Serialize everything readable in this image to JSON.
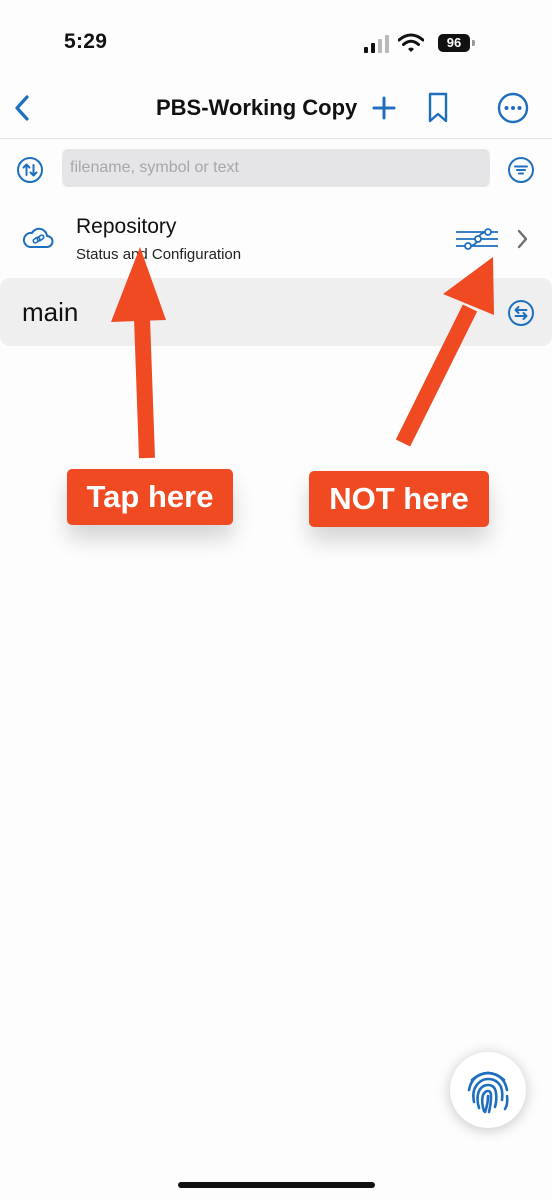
{
  "status_bar": {
    "time": "5:29",
    "battery": "96",
    "icons": [
      "cell-signal-icon",
      "wifi-icon",
      "battery-icon"
    ]
  },
  "nav": {
    "title": "PBS-Working Copy",
    "icons": [
      "chevron-left-icon",
      "plus-icon",
      "bookmark-icon",
      "ellipsis-circle-icon"
    ]
  },
  "search": {
    "placeholder": "filename, symbol or text",
    "value": "",
    "icons": [
      "sort-arrows-icon",
      "filter-icon"
    ]
  },
  "repository": {
    "title": "Repository",
    "subtitle": "Status and Configuration",
    "icons": [
      "cloud-link-icon",
      "git-graph-icon",
      "chevron-right-icon"
    ]
  },
  "branch": {
    "name": "main",
    "icon": "branch-switch-icon"
  },
  "annotations": {
    "tap_here": "Tap here",
    "not_here": "NOT here",
    "color": "#f04a23"
  },
  "fab": {
    "icon": "fingerprint-icon"
  },
  "colors": {
    "accent": "#1f6fbf",
    "row_highlight": "#efeff0",
    "annotation": "#f04a23"
  }
}
